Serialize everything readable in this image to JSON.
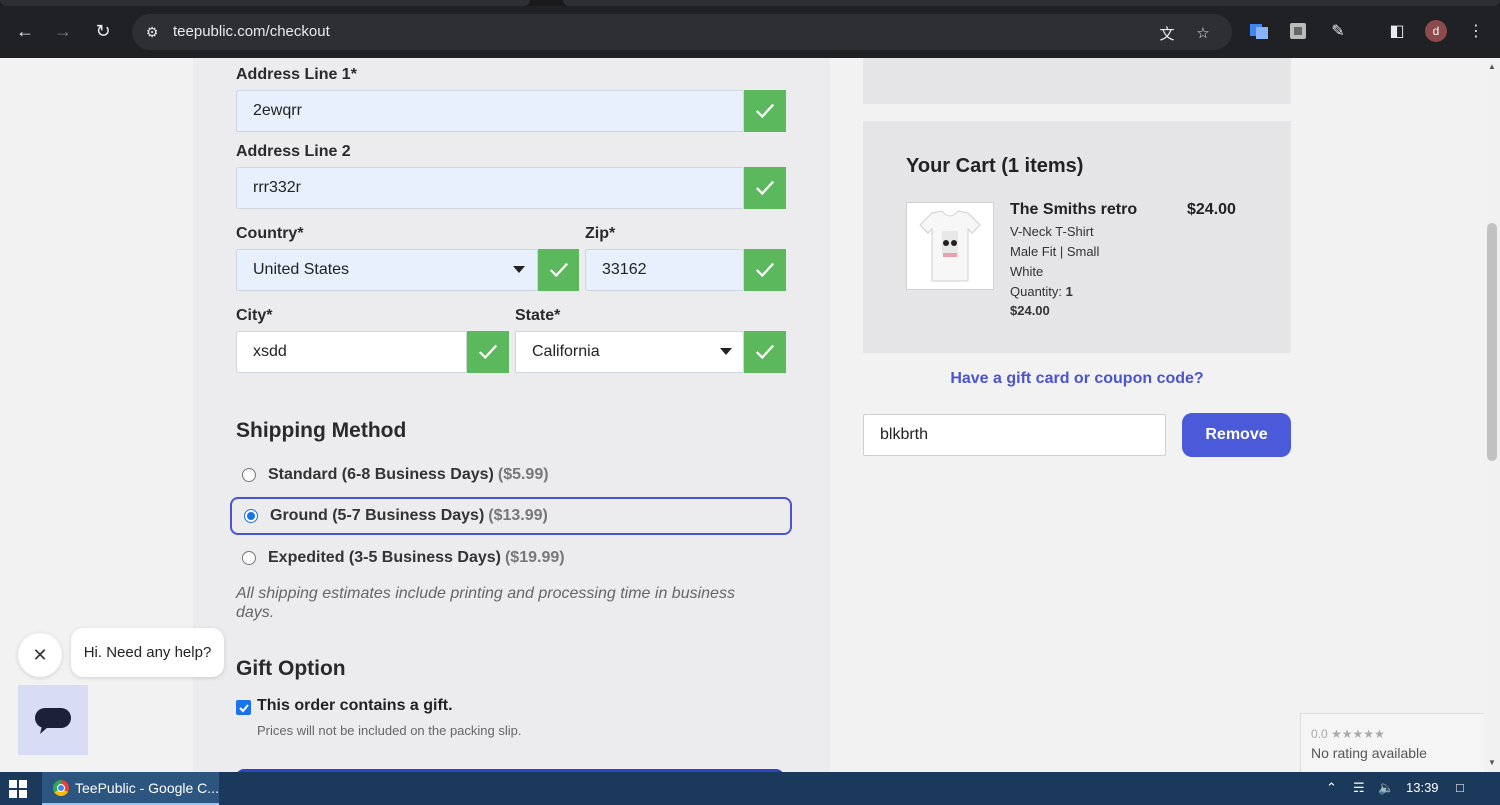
{
  "browser": {
    "url": "teepublic.com/checkout"
  },
  "address": {
    "line1_label": "Address Line 1*",
    "line1_value": "2ewqrr",
    "line2_label": "Address Line 2",
    "line2_value": "rrr332r",
    "country_label": "Country*",
    "country_value": "United States",
    "zip_label": "Zip*",
    "zip_value": "33162",
    "city_label": "City*",
    "city_value": "xsdd",
    "state_label": "State*",
    "state_value": "California"
  },
  "shipping": {
    "title": "Shipping Method",
    "options": [
      {
        "label": "Standard (6-8 Business Days)",
        "price": "($5.99)",
        "selected": false
      },
      {
        "label": "Ground (5-7 Business Days)",
        "price": "($13.99)",
        "selected": true
      },
      {
        "label": "Expedited (3-5 Business Days)",
        "price": "($19.99)",
        "selected": false
      }
    ],
    "note": "All shipping estimates include printing and processing time in business days."
  },
  "gift": {
    "title": "Gift Option",
    "checkbox_label": "This order contains a gift.",
    "sub_note": "Prices will not be included on the packing slip."
  },
  "cart": {
    "title": "Your Cart (1 items)",
    "item_name": "The Smiths retro",
    "item_price": "$24.00",
    "item_style": "V-Neck T-Shirt",
    "item_fit": "Male Fit | Small",
    "item_color": "White",
    "quantity_label": "Quantity:",
    "quantity_value": "1",
    "item_total": "$24.00"
  },
  "coupon": {
    "link_text": "Have a gift card or coupon code?",
    "value": "blkbrth",
    "remove_label": "Remove"
  },
  "chat": {
    "bubble_text": "Hi. Need any help?"
  },
  "rating_widget": {
    "score": "0.0",
    "text": "No rating available"
  },
  "taskbar": {
    "app_title": "TeePublic - Google C...",
    "time": "13:39"
  },
  "colors": {
    "accent": "#4a54cf",
    "valid_check": "#5cb85c",
    "autofill_bg": "#e8f0fe"
  }
}
